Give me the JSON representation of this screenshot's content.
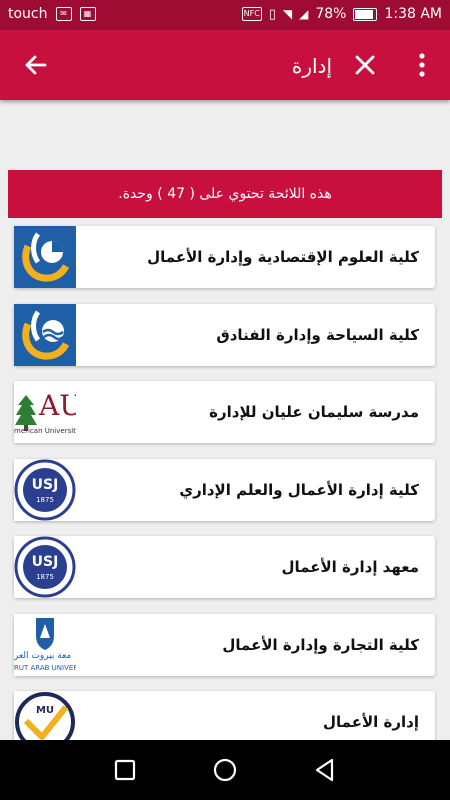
{
  "status_bar": {
    "carrier": "touch",
    "nfc": "NFC",
    "battery_percent_text": "78%",
    "battery_level": 0.78,
    "time": "1:38 AM"
  },
  "app_bar": {
    "search_query": "إدارة",
    "icons": {
      "back": "arrow-left-icon",
      "clear": "close-icon",
      "more": "more-vertical-icon"
    }
  },
  "count_banner": "هذه اللائحة تحتوي على ( 47 ) وحدة.",
  "items": [
    {
      "title": "كلية العلوم الإقتصادية وإدارة الأعمال",
      "logo": "economics-faculty-logo"
    },
    {
      "title": "كلية السياحة وإدارة الفنادق",
      "logo": "tourism-faculty-logo"
    },
    {
      "title": "مدرسة سليمان عليان للإدارة",
      "logo": "aub-logo",
      "logo_text": "AU",
      "logo_subtext": "merican University of B"
    },
    {
      "title": "كلية إدارة الأعمال والعلم الإداري",
      "logo": "usj-logo",
      "logo_text": "USJ",
      "logo_year": "1875"
    },
    {
      "title": "معهد إدارة الأعمال",
      "logo": "usj-logo",
      "logo_text": "USJ",
      "logo_year": "1875"
    },
    {
      "title": "كلية التجارة وإدارة الأعمال",
      "logo": "bau-logo",
      "logo_text": "معة بيروت العر",
      "logo_subtext": "RUT ARAB UNIVER"
    },
    {
      "title": "إدارة الأعمال",
      "logo": "mu-logo",
      "logo_text": "MU"
    }
  ],
  "colors": {
    "primary": "#c8103f",
    "status_bar": "#9e0b33",
    "background": "#eeeeee",
    "usj_blue": "#2a3f8f",
    "aub_red": "#8b1c2c",
    "lu_blue": "#1f5fa8",
    "lu_yellow": "#f2b01e"
  },
  "nav_bar": {
    "icons": [
      "recents-square-icon",
      "home-circle-icon",
      "back-triangle-icon"
    ]
  }
}
